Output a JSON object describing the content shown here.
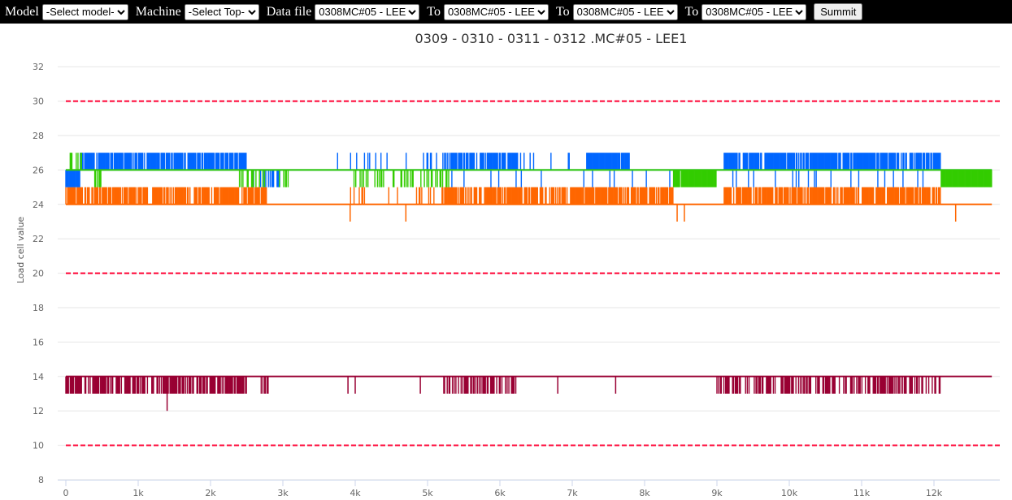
{
  "toolbar": {
    "model_label": "Model",
    "model_value": "-Select model-",
    "machine_label": "Machine",
    "machine_value": "-Select Top-",
    "datafile_label": "Data file",
    "datafile_value": "0308MC#05 - LEE",
    "to_label": "To",
    "to1_value": "0308MC#05 - LEE",
    "to2_value": "0308MC#05 - LEE",
    "to3_value": "0308MC#05 - LEE",
    "submit_label": "Summit"
  },
  "chart_data": {
    "type": "line",
    "title": "0309 - 0310 - 0311 - 0312 .MC#05 - LEE1",
    "xlabel": "",
    "ylabel": "Load cell value",
    "xlim": [
      0,
      12900
    ],
    "ylim": [
      8,
      32
    ],
    "xticks": [
      {
        "v": 0,
        "l": "0"
      },
      {
        "v": 1000,
        "l": "1k"
      },
      {
        "v": 2000,
        "l": "2k"
      },
      {
        "v": 3000,
        "l": "3k"
      },
      {
        "v": 4000,
        "l": "4k"
      },
      {
        "v": 5000,
        "l": "5k"
      },
      {
        "v": 6000,
        "l": "6k"
      },
      {
        "v": 7000,
        "l": "7k"
      },
      {
        "v": 8000,
        "l": "8k"
      },
      {
        "v": 9000,
        "l": "9k"
      },
      {
        "v": 10000,
        "l": "10k"
      },
      {
        "v": 11000,
        "l": "11k"
      },
      {
        "v": 12000,
        "l": "12k"
      }
    ],
    "yticks": [
      8,
      10,
      12,
      14,
      16,
      18,
      20,
      22,
      24,
      26,
      28,
      30,
      32
    ],
    "grid": true,
    "thresholds": [
      {
        "value": 30,
        "color": "#ff0033"
      },
      {
        "value": 20,
        "color": "#ff0033"
      },
      {
        "value": 10,
        "color": "#ff0033"
      }
    ],
    "series": [
      {
        "name": "orange",
        "color": "#ff6600",
        "baseline": 24,
        "xmax": 12800,
        "bands": [
          [
            0,
            2800,
            25,
            0.8
          ],
          [
            3900,
            5100,
            25,
            0.15
          ],
          [
            5200,
            8400,
            25,
            0.8
          ],
          [
            9100,
            12100,
            25,
            0.8
          ]
        ],
        "spikes": [
          [
            3930,
            23
          ],
          [
            4700,
            23
          ],
          [
            8450,
            23
          ],
          [
            8550,
            23
          ],
          [
            12300,
            23
          ]
        ]
      },
      {
        "name": "blue",
        "color": "#0066ff",
        "baseline": 26,
        "xmax": 12800,
        "bands": [
          [
            0,
            200,
            25,
            1
          ],
          [
            200,
            2500,
            27,
            0.85
          ],
          [
            2500,
            3000,
            25,
            0.4
          ],
          [
            3600,
            5200,
            27,
            0.15
          ],
          [
            5200,
            6250,
            27,
            0.8
          ],
          [
            6250,
            7200,
            27,
            0.1
          ],
          [
            7200,
            7800,
            27,
            0.9
          ],
          [
            9100,
            12100,
            27,
            0.85
          ],
          [
            9100,
            12100,
            25,
            0.08
          ],
          [
            5000,
            8400,
            25,
            0.05
          ]
        ],
        "spikes": []
      },
      {
        "name": "green",
        "color": "#33cc00",
        "baseline": 26,
        "xmax": 12800,
        "bands": [
          [
            0,
            300,
            27,
            0.3
          ],
          [
            400,
            500,
            25,
            0.5
          ],
          [
            2400,
            3100,
            25,
            0.3
          ],
          [
            3900,
            5300,
            25,
            0.4
          ],
          [
            8400,
            9000,
            25,
            0.95
          ],
          [
            12100,
            12800,
            25,
            1
          ]
        ],
        "spikes": []
      },
      {
        "name": "darkred",
        "color": "#990033",
        "baseline": 14,
        "xmax": 12800,
        "bands": [
          [
            0,
            2500,
            13,
            0.7
          ],
          [
            2700,
            2800,
            13,
            0.5
          ],
          [
            5200,
            6300,
            13,
            0.5
          ],
          [
            9000,
            12100,
            13,
            0.5
          ]
        ],
        "spikes": [
          [
            1400,
            12
          ],
          [
            3900,
            13
          ],
          [
            4000,
            13
          ],
          [
            4900,
            13
          ],
          [
            6800,
            13
          ],
          [
            7600,
            13
          ]
        ]
      }
    ]
  }
}
